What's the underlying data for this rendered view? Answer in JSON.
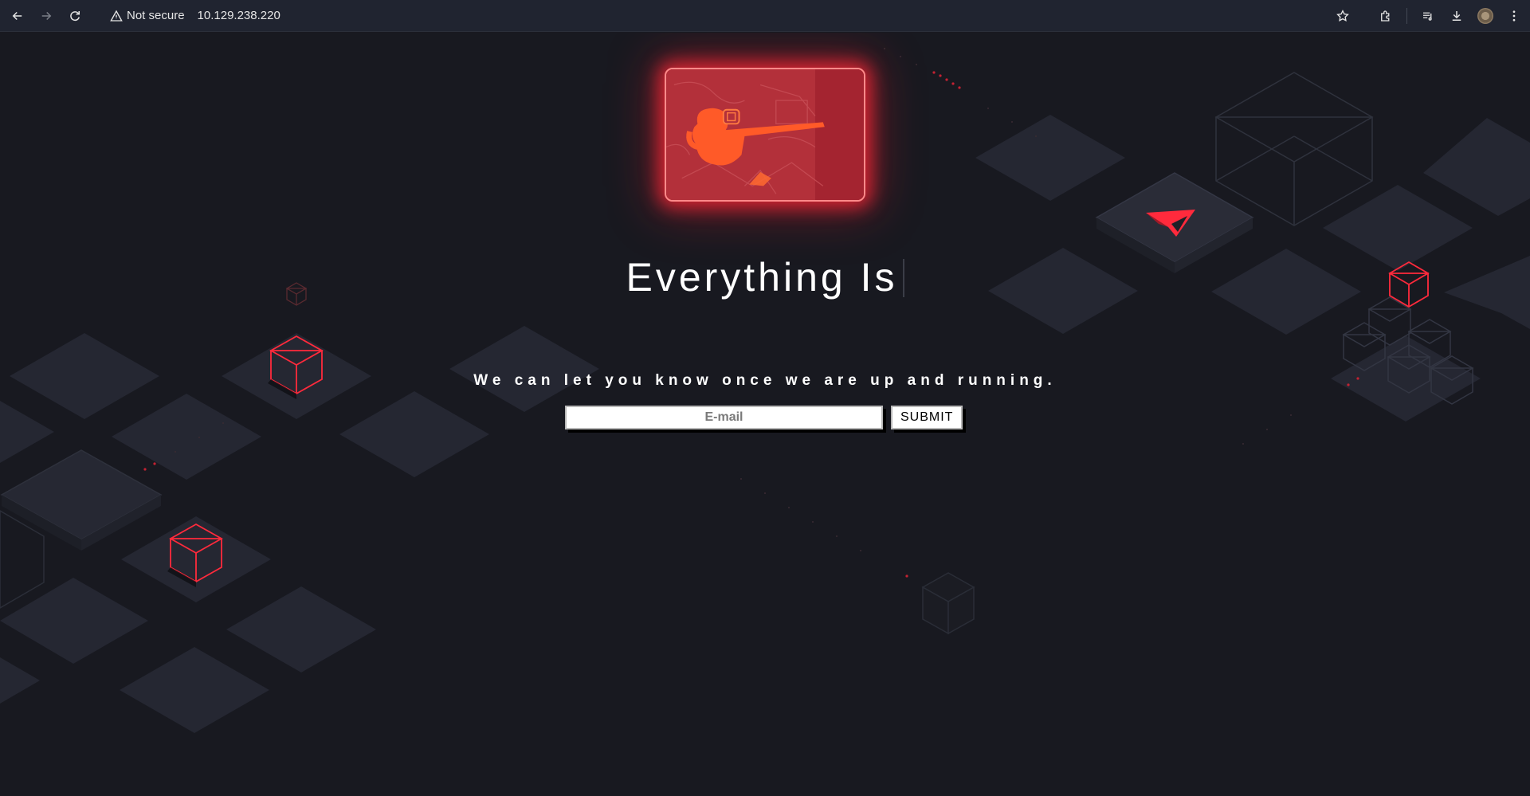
{
  "browser": {
    "security_label": "Not secure",
    "url": "10.129.238.220",
    "icons": [
      "back-arrow-icon",
      "forward-arrow-icon",
      "reload-icon",
      "warning-triangle-icon",
      "star-icon",
      "extensions-puzzle-icon",
      "media-controls-icon",
      "download-icon",
      "profile-avatar",
      "kebab-menu-icon"
    ]
  },
  "page": {
    "headline": "Everything Is",
    "tagline": "We can let you know once we are up and running.",
    "email_placeholder": "E-mail",
    "submit_label": "SUBMIT"
  },
  "colors": {
    "background": "#181920",
    "tile": "#262833",
    "accent_red": "#ff2a3c",
    "text": "#ffffff"
  }
}
